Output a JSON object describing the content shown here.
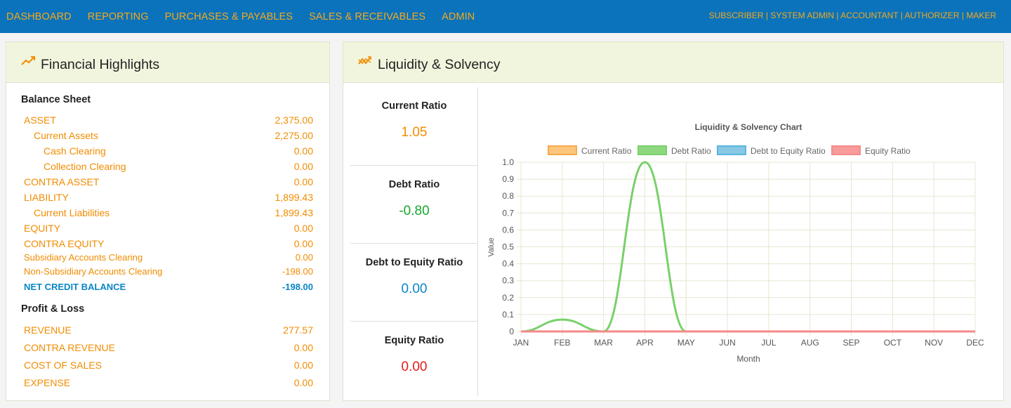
{
  "nav": {
    "items": [
      {
        "id": "dashboard",
        "label": "DASHBOARD"
      },
      {
        "id": "reporting",
        "label": "REPORTING"
      },
      {
        "id": "purchases",
        "label": "PURCHASES & PAYABLES"
      },
      {
        "id": "sales",
        "label": "SALES & RECEIVABLES"
      },
      {
        "id": "admin",
        "label": "ADMIN"
      }
    ],
    "roles": "SUBSCRIBER | SYSTEM ADMIN | ACCOUNTANT | AUTHORIZER | MAKER"
  },
  "financial": {
    "title": "Financial Highlights",
    "balance_sheet": {
      "title": "Balance Sheet",
      "rows": [
        {
          "label": "ASSET",
          "value": "2,375.00",
          "indent": 0
        },
        {
          "label": "Current Assets",
          "value": "2,275.00",
          "indent": 1
        },
        {
          "label": "Cash Clearing",
          "value": "0.00",
          "indent": 2
        },
        {
          "label": "Collection Clearing",
          "value": "0.00",
          "indent": 2
        },
        {
          "label": "CONTRA ASSET",
          "value": "0.00",
          "indent": 0
        },
        {
          "label": "LIABILITY",
          "value": "1,899.43",
          "indent": 0
        },
        {
          "label": "Current Liabilities",
          "value": "1,899.43",
          "indent": 1
        },
        {
          "label": "EQUITY",
          "value": "0.00",
          "indent": 0
        },
        {
          "label": "CONTRA EQUITY",
          "value": "0.00",
          "indent": 0
        },
        {
          "label": "Subsidiary Accounts Clearing",
          "value": "0.00",
          "indent": 0,
          "small": true
        },
        {
          "label": "Non-Subsidiary Accounts Clearing",
          "value": "-198.00",
          "indent": 0,
          "small": true
        },
        {
          "label": "NET CREDIT BALANCE",
          "value": "-198.00",
          "indent": 0,
          "total": true
        }
      ]
    },
    "profit_loss": {
      "title": "Profit & Loss",
      "rows": [
        {
          "label": "REVENUE",
          "value": "277.57"
        },
        {
          "label": "CONTRA REVENUE",
          "value": "0.00"
        },
        {
          "label": "COST OF SALES",
          "value": "0.00"
        },
        {
          "label": "EXPENSE",
          "value": "0.00"
        }
      ]
    }
  },
  "liquidity": {
    "title": "Liquidity & Solvency",
    "ratios": [
      {
        "label": "Current Ratio",
        "value": "1.05",
        "color": "#f28c00"
      },
      {
        "label": "Debt Ratio",
        "value": "-0.80",
        "color": "#18a82f"
      },
      {
        "label": "Debt to Equity Ratio",
        "value": "0.00",
        "color": "#0a86c8"
      },
      {
        "label": "Equity Ratio",
        "value": "0.00",
        "color": "#e21b1b"
      }
    ]
  },
  "chart_data": {
    "type": "line",
    "title": "Liquidity & Solvency Chart",
    "xlabel": "Month",
    "ylabel": "Value",
    "ylim": [
      0,
      1.0
    ],
    "yticks": [
      "0",
      "0.1",
      "0.2",
      "0.3",
      "0.4",
      "0.5",
      "0.6",
      "0.7",
      "0.8",
      "0.9",
      "1.0"
    ],
    "categories": [
      "JAN",
      "FEB",
      "MAR",
      "APR",
      "MAY",
      "JUN",
      "JUL",
      "AUG",
      "SEP",
      "OCT",
      "NOV",
      "DEC"
    ],
    "grid": true,
    "legend_position": "top",
    "series": [
      {
        "name": "Current Ratio",
        "values": [
          0,
          0,
          0,
          0,
          0,
          0,
          0,
          0,
          0,
          0,
          0,
          0
        ],
        "stroke": "#f9a94b",
        "fill": "#fcc67f"
      },
      {
        "name": "Debt Ratio",
        "values": [
          0,
          0.07,
          0,
          1.0,
          0,
          0,
          0,
          0,
          0,
          0,
          0,
          0
        ],
        "stroke": "#78d16a",
        "fill": "#8ed980"
      },
      {
        "name": "Debt to Equity Ratio",
        "values": [
          0,
          0,
          0,
          0,
          0,
          0,
          0,
          0,
          0,
          0,
          0,
          0
        ],
        "stroke": "#5ab6dd",
        "fill": "#88c8e4"
      },
      {
        "name": "Equity Ratio",
        "values": [
          0,
          0,
          0,
          0,
          0,
          0,
          0,
          0,
          0,
          0,
          0,
          0
        ],
        "stroke": "#f58a8a",
        "fill": "#f79b9b"
      }
    ]
  }
}
